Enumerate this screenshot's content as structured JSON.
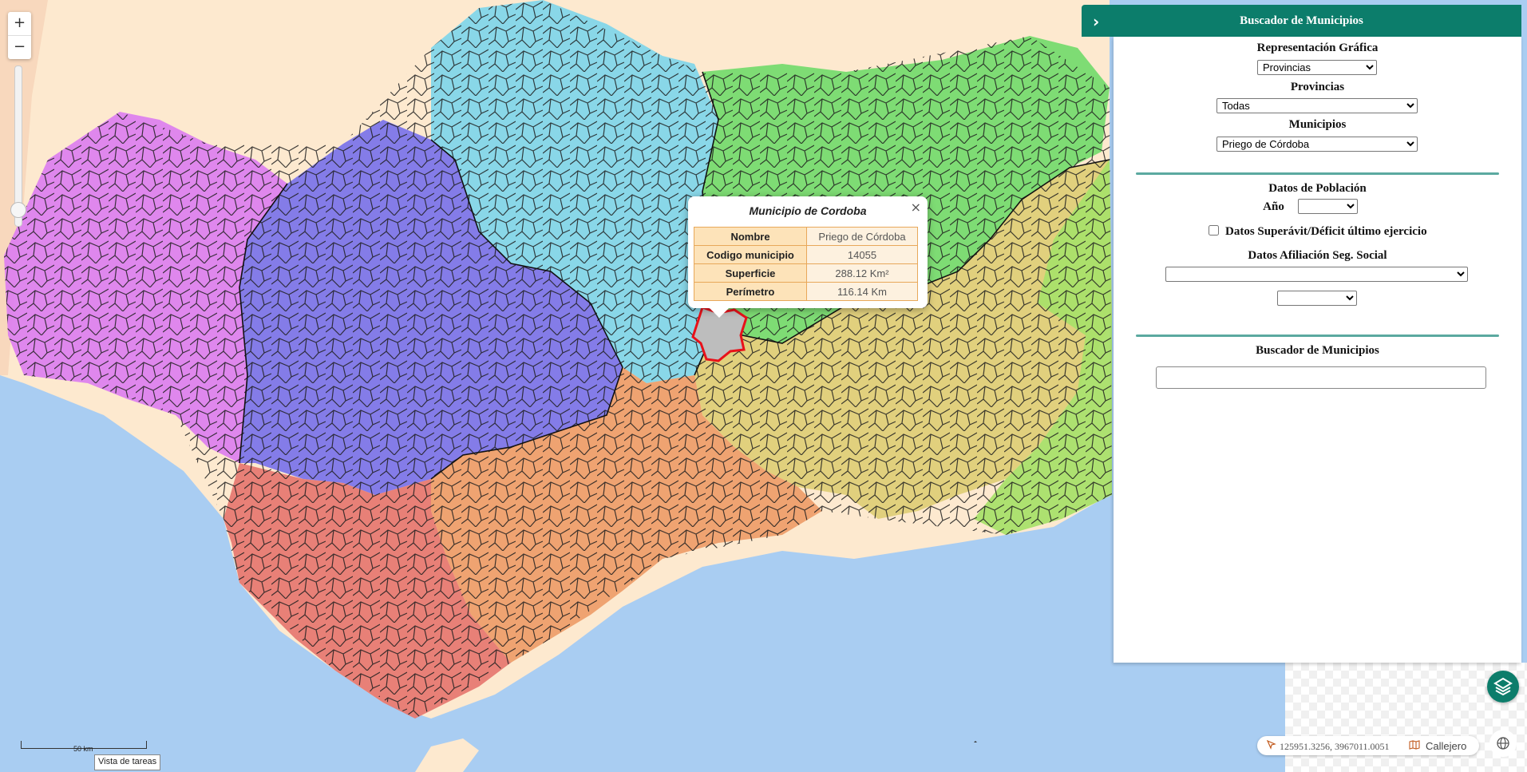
{
  "zoom": {
    "in_label": "+",
    "out_label": "−"
  },
  "popup": {
    "title": "Municipio de Cordoba",
    "close_label": "×",
    "rows": [
      {
        "key": "Nombre",
        "value": "Priego de Córdoba"
      },
      {
        "key": "Codigo municipio",
        "value": "14055"
      },
      {
        "key": "Superficie",
        "value": "288.12 Km²"
      },
      {
        "key": "Perímetro",
        "value": "116.14 Km"
      }
    ]
  },
  "panel": {
    "title": "Buscador de Municipios",
    "rep_label": "Representación Gráfica",
    "rep_value": "Provincias",
    "prov_label": "Provincias",
    "prov_value": "Todas",
    "mun_label": "Municipios",
    "mun_value": "Priego de Córdoba",
    "pob_label": "Datos de Población",
    "anio_label": "Año",
    "superavit_label": "Datos Superávit/Déficit último ejercicio",
    "afiliacion_label": "Datos Afiliación Seg. Social",
    "search_label": "Buscador de Municipios"
  },
  "coords": {
    "value": "125951.3256, 3967011.0051",
    "callejero": "Callejero"
  },
  "scale": {
    "label": "50 km"
  },
  "tooltip": "Vista de tareas",
  "colors": {
    "header": "#0c7d6b",
    "huelva": "#dc7ef0",
    "sevilla": "#7a72ea",
    "cordoba": "#7fd5ea",
    "jaen": "#77db6f",
    "granada": "#dfcf78",
    "almeria": "#a9e06a",
    "malaga": "#ee9f6c",
    "cadiz": "#e77a72",
    "sea": "#a9cdf2",
    "land": "#fde9cf",
    "selected": "#bdbdbd"
  }
}
